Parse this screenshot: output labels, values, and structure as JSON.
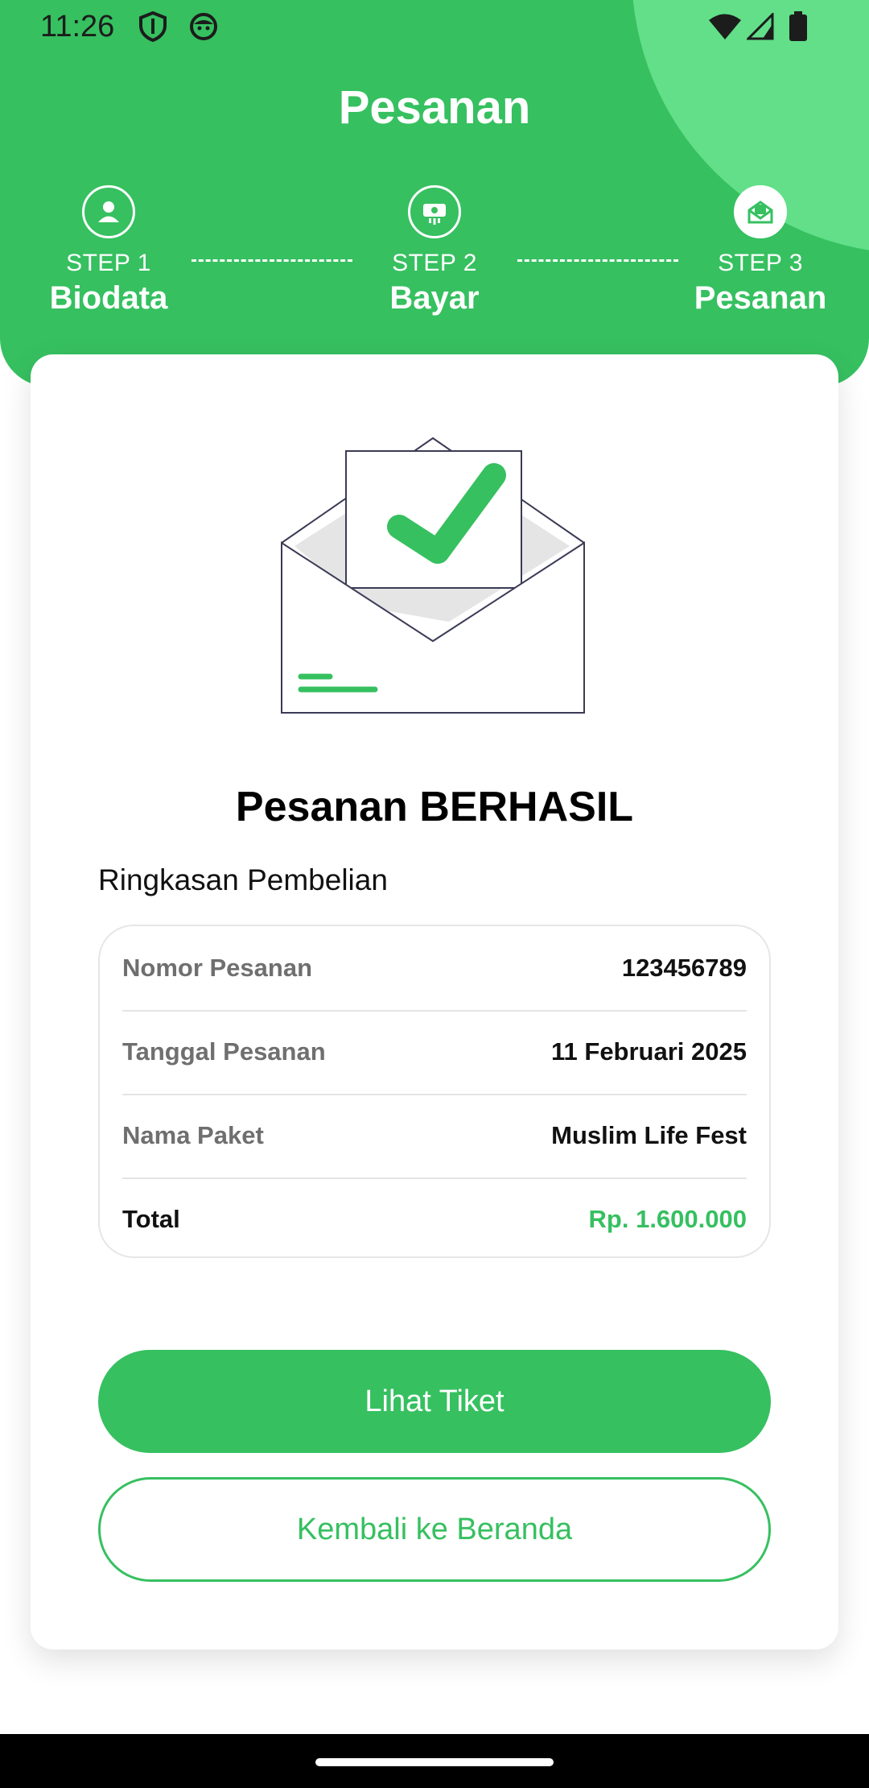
{
  "status_bar": {
    "time": "11:26"
  },
  "header": {
    "title": "Pesanan"
  },
  "steps": [
    {
      "label": "STEP 1",
      "name": "Biodata",
      "icon": "user-icon"
    },
    {
      "label": "STEP 2",
      "name": "Bayar",
      "icon": "payment-icon"
    },
    {
      "label": "STEP 3",
      "name": "Pesanan",
      "icon": "order-icon"
    }
  ],
  "result": {
    "title": "Pesanan BERHASIL",
    "summary_heading": "Ringkasan Pembelian",
    "rows": [
      {
        "label": "Nomor Pesanan",
        "value": "123456789"
      },
      {
        "label": "Tanggal Pesanan",
        "value": "11 Februari 2025"
      },
      {
        "label": "Nama Paket",
        "value": "Muslim Life Fest"
      },
      {
        "label": "Total",
        "value": "Rp. 1.600.000"
      }
    ]
  },
  "buttons": {
    "primary": "Lihat Tiket",
    "secondary": "Kembali ke Beranda"
  },
  "colors": {
    "accent": "#36c060",
    "accent_light": "#62df88"
  }
}
